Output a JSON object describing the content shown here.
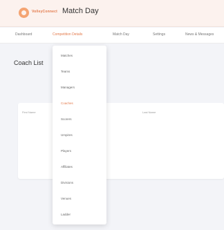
{
  "header": {
    "brand": "VolleyConnect",
    "title": "Match Day",
    "accent_color": "#e37a4b"
  },
  "nav": {
    "items": [
      {
        "label": "Dashboard"
      },
      {
        "label": "Competition Details"
      },
      {
        "label": "Match Day"
      },
      {
        "label": "Settings"
      },
      {
        "label": "News & Messages"
      }
    ],
    "active_index": 1
  },
  "page": {
    "title": "Coach List"
  },
  "table": {
    "columns": [
      "First Name",
      "Last Name"
    ]
  },
  "dropdown": {
    "items": [
      "Matches",
      "Teams",
      "Managers",
      "Coaches",
      "Scorers",
      "Umpires",
      "Players",
      "Affiliates",
      "Divisions",
      "Venues",
      "Ladder"
    ],
    "active_index": 3
  }
}
